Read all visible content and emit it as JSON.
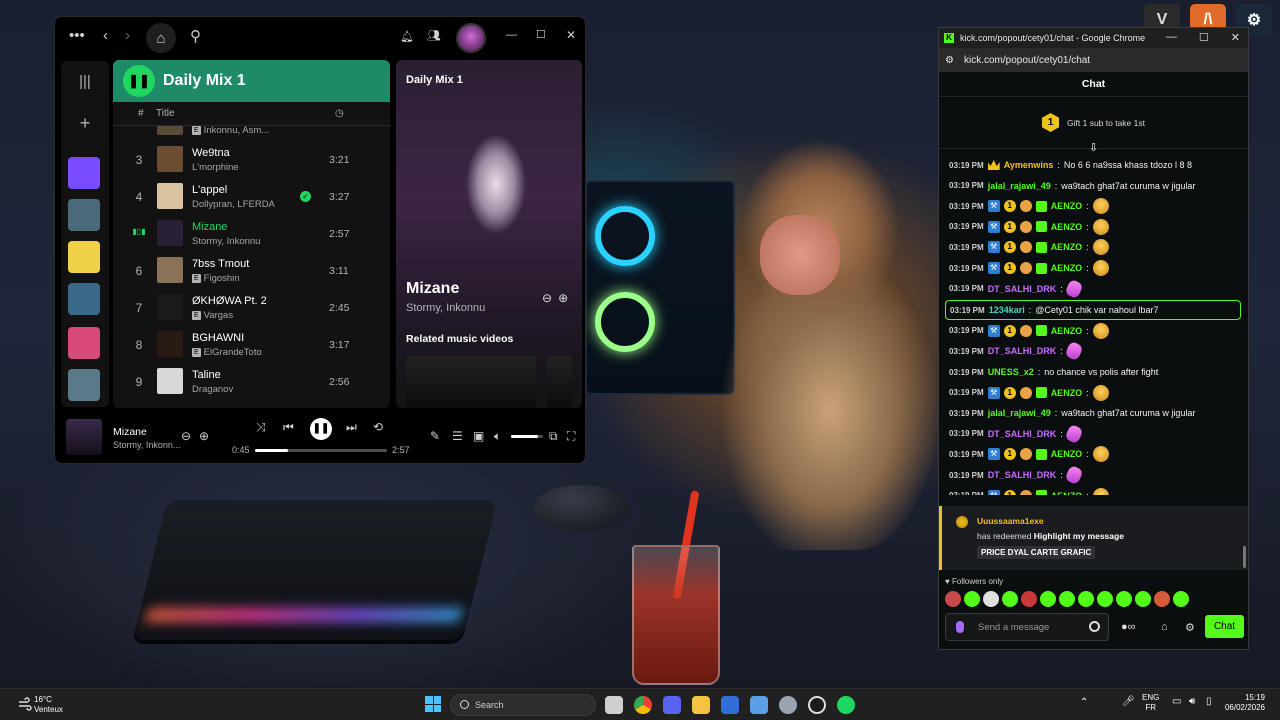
{
  "desktop": {
    "icons": [
      {
        "name": "gta-v-icon",
        "color": "#2b2b2b",
        "glyph": "V"
      },
      {
        "name": "app-orange-icon",
        "color": "#e06a2a",
        "glyph": "/\\"
      },
      {
        "name": "steam-icon",
        "color": "#1b2838",
        "glyph": "⚙"
      }
    ]
  },
  "spotify": {
    "playlist_title": "Daily Mix 1",
    "columns": {
      "number": "#",
      "title": "Title"
    },
    "tracks": [
      {
        "num": "",
        "name": "",
        "artist": "Inkonnu, Asm...",
        "explicit": true,
        "duration": "",
        "art": "#5a4a3a"
      },
      {
        "num": "3",
        "name": "We9tna",
        "artist": "L'morphine",
        "explicit": false,
        "duration": "3:21",
        "art": "#6b4e32"
      },
      {
        "num": "4",
        "name": "L'appel",
        "artist": "Dollypran, LFERDA",
        "explicit": false,
        "duration": "3:27",
        "art": "#d9c3a0",
        "saved": true
      },
      {
        "num": "",
        "name": "Mizane",
        "artist": "Stormy, Inkonnu",
        "explicit": false,
        "duration": "2:57",
        "art": "#2a2036",
        "active": true
      },
      {
        "num": "6",
        "name": "7bss Tmout",
        "artist": "Figoshin",
        "explicit": true,
        "duration": "3:11",
        "art": "#8a7258"
      },
      {
        "num": "7",
        "name": "ØKHØWA Pt. 2",
        "artist": "Vargas",
        "explicit": true,
        "duration": "2:45",
        "art": "#1a1a1a"
      },
      {
        "num": "8",
        "name": "BGHAWNI",
        "artist": "ElGrandeToto",
        "explicit": true,
        "duration": "3:17",
        "art": "#2a1a14"
      },
      {
        "num": "9",
        "name": "Taline",
        "artist": "Draganov",
        "explicit": false,
        "duration": "2:56",
        "art": "#d8d8d8"
      }
    ],
    "now_playing_panel": {
      "label": "Daily Mix 1",
      "title": "Mizane",
      "artist": "Stormy, Inkonnu",
      "related": "Related music videos"
    },
    "player": {
      "title": "Mizane",
      "artist": "Stormy, Inkonn...",
      "elapsed": "0:45",
      "total": "2:57",
      "progress": 0.25,
      "volume": 0.85
    },
    "library_thumbs": [
      "#7a4cff",
      "#4a6a7a",
      "#f0d24a",
      "#3a6a8a",
      "#d84a7a",
      "#5a7a8a",
      "#c8567a"
    ]
  },
  "chrome": {
    "title": "kick.com/popout/cety01/chat - Google Chrome",
    "url": "kick.com/popout/cety01/chat"
  },
  "chat": {
    "header": "Chat",
    "gift_badge": "1",
    "gift_text": "Gift 1 sub to take 1st",
    "messages": [
      {
        "ts": "03:19 PM",
        "badges": [
          "crown"
        ],
        "user": "Aymenwins",
        "color": "#f1c21b",
        "text": "No 6 6 na9ssa khass tdozo l 8 8"
      },
      {
        "ts": "03:19 PM",
        "badges": [],
        "user": "jalal_rajawi_49",
        "color": "#53fc18",
        "text": "wa9tach ghat7at curuma w jigular"
      },
      {
        "ts": "03:19 PM",
        "badges": [
          "blue",
          "gold",
          "face",
          "green"
        ],
        "user": "AENZO",
        "color": "#53fc18",
        "text": "",
        "emote": "face"
      },
      {
        "ts": "03:19 PM",
        "badges": [
          "blue",
          "gold",
          "face",
          "green"
        ],
        "user": "AENZO",
        "color": "#53fc18",
        "text": "",
        "emote": "face"
      },
      {
        "ts": "03:19 PM",
        "badges": [
          "blue",
          "gold",
          "face",
          "green"
        ],
        "user": "AENZO",
        "color": "#53fc18",
        "text": "",
        "emote": "face"
      },
      {
        "ts": "03:19 PM",
        "badges": [
          "blue",
          "gold",
          "face",
          "green"
        ],
        "user": "AENZO",
        "color": "#53fc18",
        "text": "",
        "emote": "face"
      },
      {
        "ts": "03:19 PM",
        "badges": [],
        "user": "DT_SALHI_DRK",
        "color": "#c86cff",
        "text": "",
        "emote": "pink"
      },
      {
        "ts": "03:19 PM",
        "badges": [],
        "user": "1234kari",
        "color": "#4ad7c0",
        "text": "@Cety01 chik var nahoul lbar7",
        "highlight": true
      },
      {
        "ts": "03:19 PM",
        "badges": [
          "blue",
          "gold",
          "face",
          "green"
        ],
        "user": "AENZO",
        "color": "#53fc18",
        "text": "",
        "emote": "face"
      },
      {
        "ts": "03:19 PM",
        "badges": [],
        "user": "DT_SALHI_DRK",
        "color": "#c86cff",
        "text": "",
        "emote": "pink"
      },
      {
        "ts": "03:19 PM",
        "badges": [],
        "user": "UNESS_x2",
        "color": "#53fc18",
        "text": "no chance vs polis after fight"
      },
      {
        "ts": "03:19 PM",
        "badges": [
          "blue",
          "gold",
          "face",
          "green"
        ],
        "user": "AENZO",
        "color": "#53fc18",
        "text": "",
        "emote": "face"
      },
      {
        "ts": "03:19 PM",
        "badges": [],
        "user": "jalal_rajawi_49",
        "color": "#53fc18",
        "text": "wa9tach ghat7at curuma w jigular"
      },
      {
        "ts": "03:19 PM",
        "badges": [],
        "user": "DT_SALHI_DRK",
        "color": "#c86cff",
        "text": "",
        "emote": "pink"
      },
      {
        "ts": "03:19 PM",
        "badges": [
          "blue",
          "gold",
          "face",
          "green"
        ],
        "user": "AENZO",
        "color": "#53fc18",
        "text": "",
        "emote": "face"
      },
      {
        "ts": "03:19 PM",
        "badges": [],
        "user": "DT_SALHI_DRK",
        "color": "#c86cff",
        "text": "",
        "emote": "pink"
      },
      {
        "ts": "03:19 PM",
        "badges": [
          "blue",
          "gold",
          "face",
          "green"
        ],
        "user": "AENZO",
        "color": "#53fc18",
        "text": "",
        "emote": "face"
      }
    ],
    "redeem": {
      "user": "Uuussaama1exe",
      "text_prefix": "has redeemed",
      "reward": "Highlight my message",
      "message": "PRICE DYAL CARTE GRAFIC"
    },
    "followers_only": "Followers only",
    "input_placeholder": "Send a message",
    "send_label": "Chat",
    "emote_colors": [
      "#c84a4a",
      "#53fc18",
      "#e0e0e0",
      "#53fc18",
      "#c83a3a",
      "#53fc18",
      "#53fc18",
      "#53fc18",
      "#53fc18",
      "#53fc18",
      "#53fc18",
      "#d85a3a",
      "#53fc18"
    ]
  },
  "taskbar": {
    "weather_temp": "16°C",
    "weather_desc": "Venteux",
    "search_placeholder": "Search",
    "lang": "ENG",
    "region": "FR",
    "time": "15:19",
    "date": "06/02/2026"
  }
}
